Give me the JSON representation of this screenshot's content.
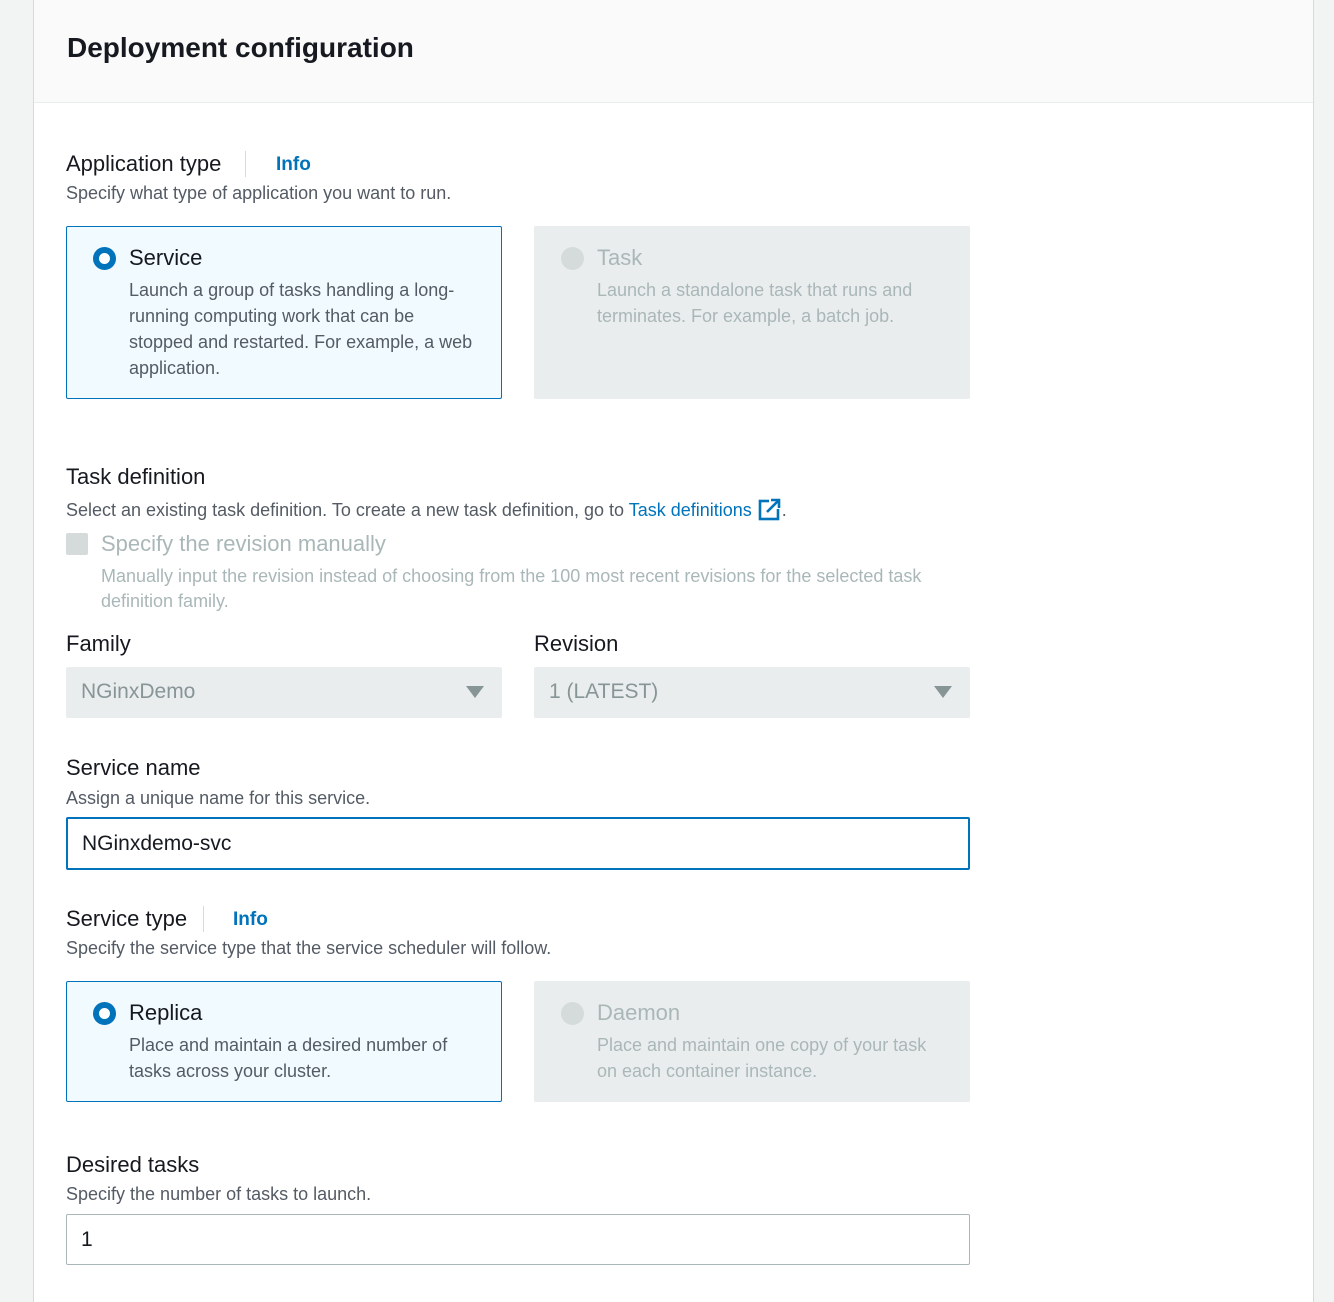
{
  "panel": {
    "title": "Deployment configuration"
  },
  "application_type": {
    "label": "Application type",
    "info": "Info",
    "description": "Specify what type of application you want to run.",
    "options": [
      {
        "title": "Service",
        "description": "Launch a group of tasks handling a long-running computing work that can be stopped and restarted. For example, a web application.",
        "selected": true,
        "disabled": false
      },
      {
        "title": "Task",
        "description": "Launch a standalone task that runs and terminates. For example, a batch job.",
        "selected": false,
        "disabled": true
      }
    ]
  },
  "task_definition": {
    "label": "Task definition",
    "description_prefix": "Select an existing task definition. To create a new task definition, go to ",
    "link_text": "Task definitions",
    "description_suffix": ".",
    "manual_revision": {
      "label": "Specify the revision manually",
      "description": "Manually input the revision instead of choosing from the 100 most recent revisions for the selected task definition family.",
      "checked": false
    },
    "family": {
      "label": "Family",
      "value": "NGinxDemo"
    },
    "revision": {
      "label": "Revision",
      "value": "1 (LATEST)"
    }
  },
  "service_name": {
    "label": "Service name",
    "description": "Assign a unique name for this service.",
    "value": "NGinxdemo-svc"
  },
  "service_type": {
    "label": "Service type",
    "info": "Info",
    "description": "Specify the service type that the service scheduler will follow.",
    "options": [
      {
        "title": "Replica",
        "description": "Place and maintain a desired number of tasks across your cluster.",
        "selected": true,
        "disabled": false
      },
      {
        "title": "Daemon",
        "description": "Place and maintain one copy of your task on each container instance.",
        "selected": false,
        "disabled": true
      }
    ]
  },
  "desired_tasks": {
    "label": "Desired tasks",
    "description": "Specify the number of tasks to launch.",
    "value": "1"
  },
  "colors": {
    "accent": "#0073bb",
    "selected_bg": "#f1faff",
    "disabled_bg": "#eaeded"
  }
}
